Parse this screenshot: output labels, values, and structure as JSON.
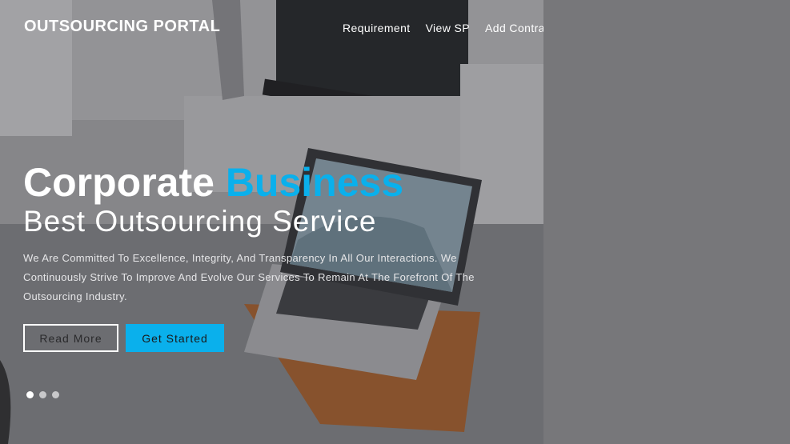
{
  "brand": {
    "name": "OUTSOURCING PORTAL"
  },
  "nav": {
    "items": [
      {
        "label": "Requirement"
      },
      {
        "label": "View SP"
      },
      {
        "label": "Add Contract"
      }
    ]
  },
  "hero": {
    "title_main": "Corporate",
    "title_accent": "Business",
    "subtitle": "Best Outsourcing Service",
    "description": "We Are Committed To Excellence, Integrity, And Transparency In All Our Interactions. We Continuously Strive To Improve And Evolve Our Services To Remain At The Forefront Of The Outsourcing Industry.",
    "buttons": {
      "read_more": "Read More",
      "get_started": "Get Started"
    },
    "slider": {
      "slide_count": 3,
      "active_index": 0
    }
  },
  "colors": {
    "accent": "#0ab0ec",
    "page_background": "#77777a",
    "text": "#ffffff"
  }
}
